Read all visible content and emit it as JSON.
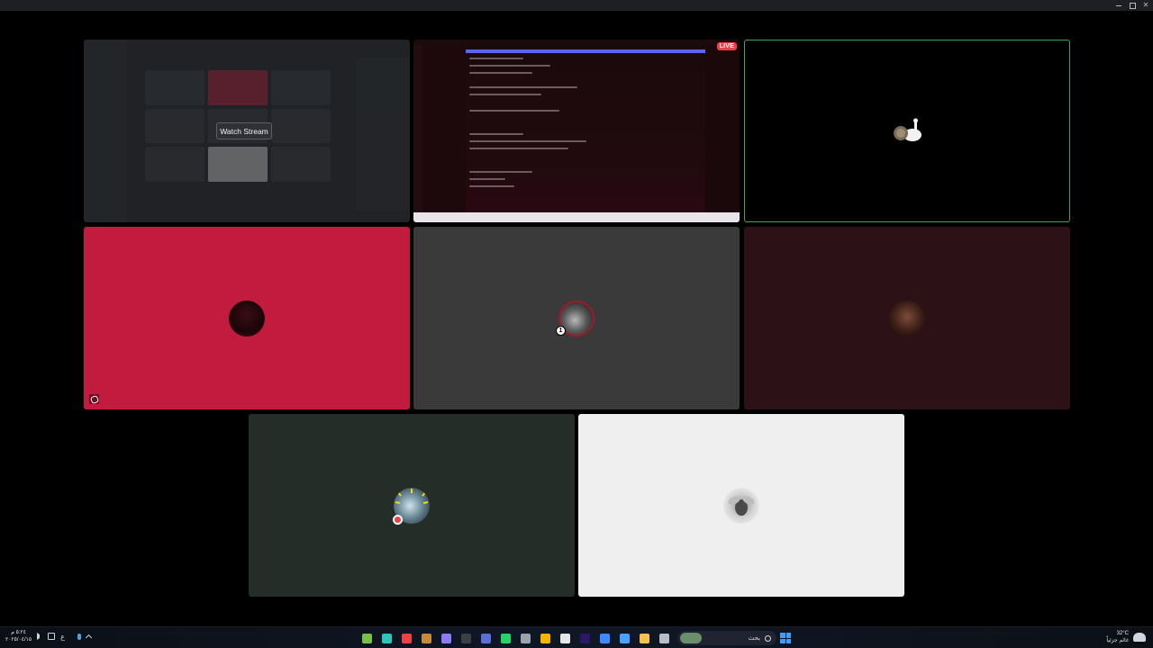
{
  "window": {
    "controls": [
      "minimize",
      "maximize",
      "close"
    ],
    "close_glyph": "✕"
  },
  "tiles": {
    "stream_preview": {
      "watch_label": "Watch Stream"
    },
    "live_screen": {
      "live_label": "LIVE"
    },
    "gray": {
      "badge": "1"
    }
  },
  "taskbar": {
    "clock_time": "٥:٢٤ م",
    "clock_date": "٢٠٢٥/٠٤/١٥",
    "lang": "ع",
    "search_label": "بحث",
    "weather_temp": "32°C",
    "weather_desc": "غائم جزئياً",
    "apps": [
      {
        "name": "gear-app-icon",
        "color": "#7bbf4a"
      },
      {
        "name": "terminal-app-icon",
        "color": "#2ec4b6"
      },
      {
        "name": "discord-app-icon",
        "color": "#ed4245"
      },
      {
        "name": "game-app-icon",
        "color": "#c58a3a"
      },
      {
        "name": "chat-app-icon",
        "color": "#8a7cf2"
      },
      {
        "name": "xbox-app-icon",
        "color": "#3c3f45"
      },
      {
        "name": "moon-app-icon",
        "color": "#5b6fd6"
      },
      {
        "name": "whatsapp-app-icon",
        "color": "#25d366"
      },
      {
        "name": "steam-app-icon",
        "color": "#9aa3ad"
      },
      {
        "name": "chrome-app-icon",
        "color": "#f4b400"
      },
      {
        "name": "store-app-icon",
        "color": "#e6e6e6"
      },
      {
        "name": "premiere-app-icon",
        "color": "#2a1a66"
      },
      {
        "name": "paint-app-icon",
        "color": "#3d8bff"
      },
      {
        "name": "photos-app-icon",
        "color": "#49a2ff"
      },
      {
        "name": "folder-app-icon",
        "color": "#f2c14e"
      },
      {
        "name": "notepad-app-icon",
        "color": "#b9bcc4"
      }
    ]
  }
}
